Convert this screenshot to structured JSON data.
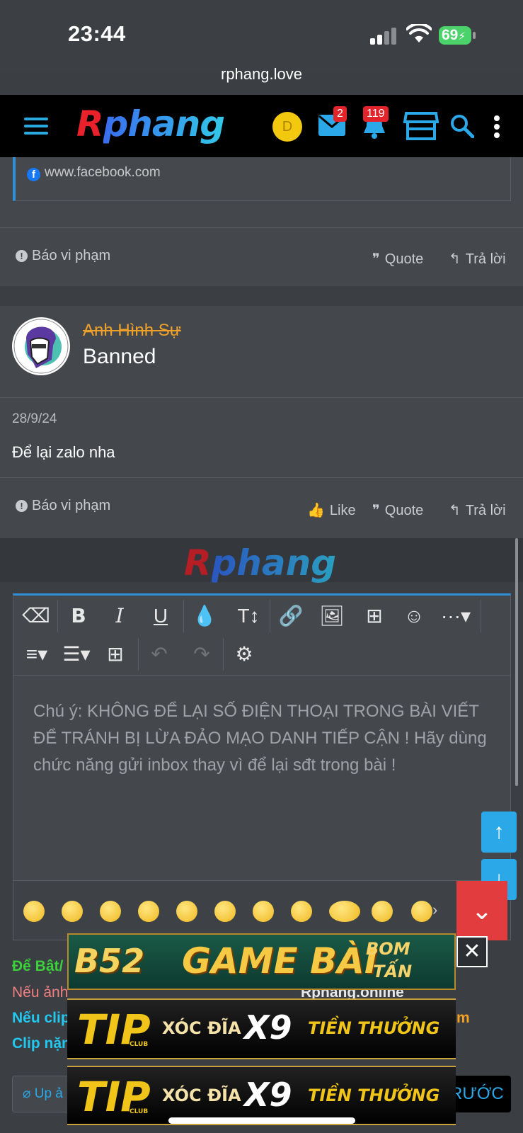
{
  "status": {
    "time": "23:44",
    "battery": "69"
  },
  "browser": {
    "url": "rphang.love"
  },
  "nav": {
    "logo_r": "R",
    "logo_rest": "phang",
    "avatar_letter": "D",
    "inbox_count": "2",
    "alerts_count": "119"
  },
  "prev_post": {
    "link_text": "www.facebook.com",
    "report": "Báo vi phạm",
    "quote": "Quote",
    "reply": "Trả lời"
  },
  "post": {
    "username": "Anh Hình Sự",
    "user_title": "Banned",
    "date": "28/9/24",
    "body": "Để lại zalo nha",
    "report": "Báo vi phạm",
    "like": "Like",
    "quote": "Quote",
    "reply": "Trả lời"
  },
  "strip_logo": {
    "r": "R",
    "rest": "phang"
  },
  "editor": {
    "placeholder": "Chú ý: KHÔNG ĐỂ LẠI SỐ ĐIỆN THOẠI TRONG BÀI VIẾT ĐỂ TRÁNH BỊ LỪA ĐẢO MẠO DANH TIẾP CẬN ! Hãy dùng chức năng gửi inbox thay vì để lại sđt trong bài !"
  },
  "notes": {
    "line1": "Để Bật/",
    "line2_start": "Nếu ảnh",
    "line2_end": "Rphang.online",
    "line3_start": "Nếu clip",
    "line3_end": "m",
    "line4_start": "Clip nặn"
  },
  "ads": {
    "b52_brand": "B52",
    "b52_main": "GAME BÀI",
    "b52_side1": "BOM",
    "b52_side2": "TẤN",
    "tip_brand": "TIP",
    "tip_club": "CLUB",
    "tip_text1": "XÓC ĐĨA",
    "tip_text2": "X9",
    "tip_text3": "TIỀN THƯỞNG",
    "close": "✕"
  },
  "bottom": {
    "upload": "Up ả",
    "submit": "RƯỚC"
  },
  "colors": {
    "accent": "#2aa8e8",
    "username": "#f0a12a",
    "note_green": "#3ad13a",
    "note_pink": "#f08080",
    "note_cyan": "#21c8f0",
    "note_orange": "#f5a020"
  }
}
